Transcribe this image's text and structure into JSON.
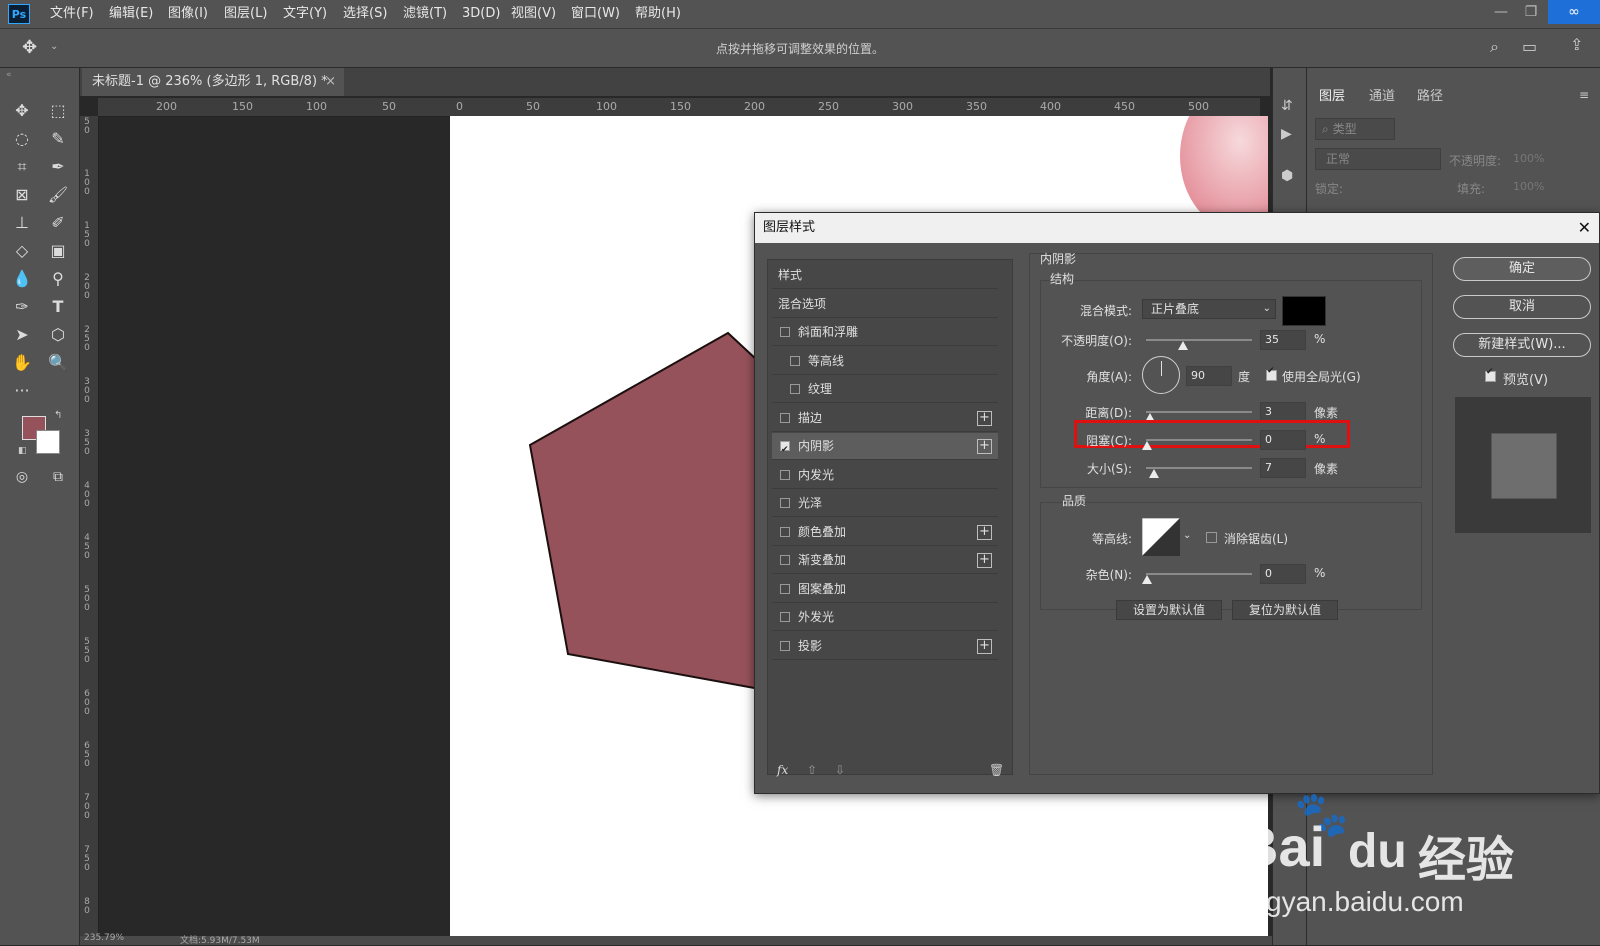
{
  "app": {
    "logo": "Ps",
    "menu": [
      "文件(F)",
      "编辑(E)",
      "图像(I)",
      "图层(L)",
      "文字(Y)",
      "选择(S)",
      "滤镜(T)",
      "3D(D)",
      "视图(V)",
      "窗口(W)",
      "帮助(H)"
    ]
  },
  "options_bar": {
    "hint": "点按并拖移可调整效果的位置。"
  },
  "document": {
    "tab_label": "未标题-1 @ 236% (多边形 1, RGB/8) *",
    "tab_close": "×"
  },
  "ruler": {
    "h_ticks": [
      "200",
      "150",
      "100",
      "50",
      "0",
      "50",
      "100",
      "150",
      "200",
      "250",
      "300",
      "350",
      "400",
      "450",
      "500"
    ],
    "v_ticks": [
      "5\n0",
      "1\n0\n0",
      "1\n5\n0",
      "2\n0\n0",
      "2\n5\n0",
      "3\n0\n0",
      "3\n5\n0",
      "4\n0\n0",
      "4\n5\n0",
      "5\n0\n0",
      "5\n5\n0",
      "6\n0\n0",
      "6\n5\n0",
      "7\n0\n0",
      "7\n5\n0",
      "8\n0"
    ]
  },
  "colors": {
    "foreground": "#96525a",
    "background": "#ffffff",
    "shape_fill": "#96525a",
    "highlight": "#e01010"
  },
  "panels": {
    "tabs": [
      "图层",
      "通道",
      "路径"
    ],
    "filter_placeholder": "类型",
    "blend_mode": "正常",
    "opacity_label": "不透明度:",
    "opacity_value": "100%",
    "lock_label": "锁定:",
    "fill_label": "填充:",
    "fill_value": "100%"
  },
  "dialog": {
    "title": "图层样式",
    "close": "✕",
    "style_list": [
      {
        "label": "样式",
        "type": "header"
      },
      {
        "label": "混合选项",
        "type": "header"
      },
      {
        "label": "斜面和浮雕",
        "checked": false,
        "plus": false,
        "indent": false
      },
      {
        "label": "等高线",
        "checked": false,
        "plus": false,
        "indent": true
      },
      {
        "label": "纹理",
        "checked": false,
        "plus": false,
        "indent": true
      },
      {
        "label": "描边",
        "checked": false,
        "plus": true,
        "indent": false
      },
      {
        "label": "内阴影",
        "checked": true,
        "plus": true,
        "indent": false,
        "selected": true
      },
      {
        "label": "内发光",
        "checked": false,
        "plus": false,
        "indent": false
      },
      {
        "label": "光泽",
        "checked": false,
        "plus": false,
        "indent": false
      },
      {
        "label": "颜色叠加",
        "checked": false,
        "plus": true,
        "indent": false
      },
      {
        "label": "渐变叠加",
        "checked": false,
        "plus": true,
        "indent": false
      },
      {
        "label": "图案叠加",
        "checked": false,
        "plus": false,
        "indent": false
      },
      {
        "label": "外发光",
        "checked": false,
        "plus": false,
        "indent": false
      },
      {
        "label": "投影",
        "checked": false,
        "plus": true,
        "indent": false
      }
    ],
    "footer_fx": "fx",
    "section_title": "内阴影",
    "structure_title": "结构",
    "blend_mode_label": "混合模式:",
    "blend_mode_value": "正片叠底",
    "shadow_color": "#000000",
    "opacity_label": "不透明度(O):",
    "opacity_value": "35",
    "opacity_unit": "%",
    "angle_label": "角度(A):",
    "angle_value": "90",
    "angle_unit": "度",
    "global_light_label": "使用全局光(G)",
    "global_light_checked": true,
    "distance_label": "距离(D):",
    "distance_value": "3",
    "distance_unit": "像素",
    "choke_label": "阻塞(C):",
    "choke_value": "0",
    "choke_unit": "%",
    "size_label": "大小(S):",
    "size_value": "7",
    "size_unit": "像素",
    "quality_title": "品质",
    "contour_label": "等高线:",
    "antialias_label": "消除锯齿(L)",
    "noise_label": "杂色(N):",
    "noise_value": "0",
    "noise_unit": "%",
    "make_default": "设置为默认值",
    "reset_default": "复位为默认值",
    "ok": "确定",
    "cancel": "取消",
    "new_style": "新建样式(W)...",
    "preview_label": "预览(V)",
    "preview_checked": true
  },
  "status": {
    "zoom": "235.79%",
    "doc": "文档:5.93M/7.53M"
  },
  "watermark": {
    "brand": "Bai",
    "brand2": "du",
    "brand_cn": "经验",
    "url": "jingyan.baidu.com"
  }
}
